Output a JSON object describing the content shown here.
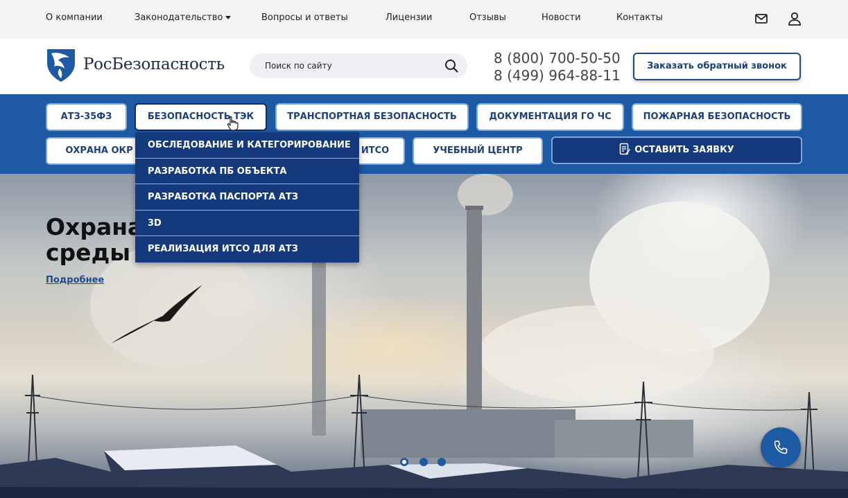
{
  "topnav": {
    "items": [
      "О компании",
      "Законодательство",
      "Вопросы и ответы",
      "Лицензии",
      "Отзывы",
      "Новости",
      "Контакты"
    ]
  },
  "icons": {
    "mail": "envelope-icon",
    "user": "user-icon",
    "search": "search-icon",
    "phone": "phone-icon",
    "logo": "eagle-shield-logo"
  },
  "header": {
    "logo_text": "РосБезопасность",
    "search_placeholder": "Поиск по сайту",
    "phone1": "8 (800) 700-50-50",
    "phone2": "8 (499) 964-88-11",
    "callback_label": "Заказать обратный звонок"
  },
  "categories": {
    "row1": [
      "АТЗ-35ФЗ",
      "БЕЗОПАСНОСТЬ ТЭК",
      "ТРАНСПОРТНАЯ БЕЗОПАСНОСТЬ",
      "ДОКУМЕНТАЦИЯ ГО ЧС",
      "ПОЖАРНАЯ БЕЗОПАСНОСТЬ"
    ],
    "row2": [
      "ОХРАНА ОКР",
      "ИТСО",
      "УЧЕБНЫЙ ЦЕНТР"
    ],
    "cta": "ОСТАВИТЬ ЗАЯВКУ",
    "active": "БЕЗОПАСНОСТЬ ТЭК"
  },
  "dropdown": {
    "items": [
      "ОБСЛЕДОВАНИЕ И КАТЕГОРИРОВАНИЕ",
      "РАЗРАБОТКА ПБ ОБЪЕКТА",
      "РАЗРАБОТКА ПАСПОРТА АТЗ",
      "3D",
      "РЕАЛИЗАЦИЯ ИТСО ДЛЯ АТЗ"
    ]
  },
  "hero": {
    "title_line1": "Охрана",
    "title_line2": "среды",
    "more_link": "Подробнее",
    "slides_total": 3,
    "slide_active": 1
  },
  "colors": {
    "brand_blue": "#1e5aa3",
    "dark_blue": "#143a7d",
    "topbar_bg": "#f2f3f5"
  }
}
